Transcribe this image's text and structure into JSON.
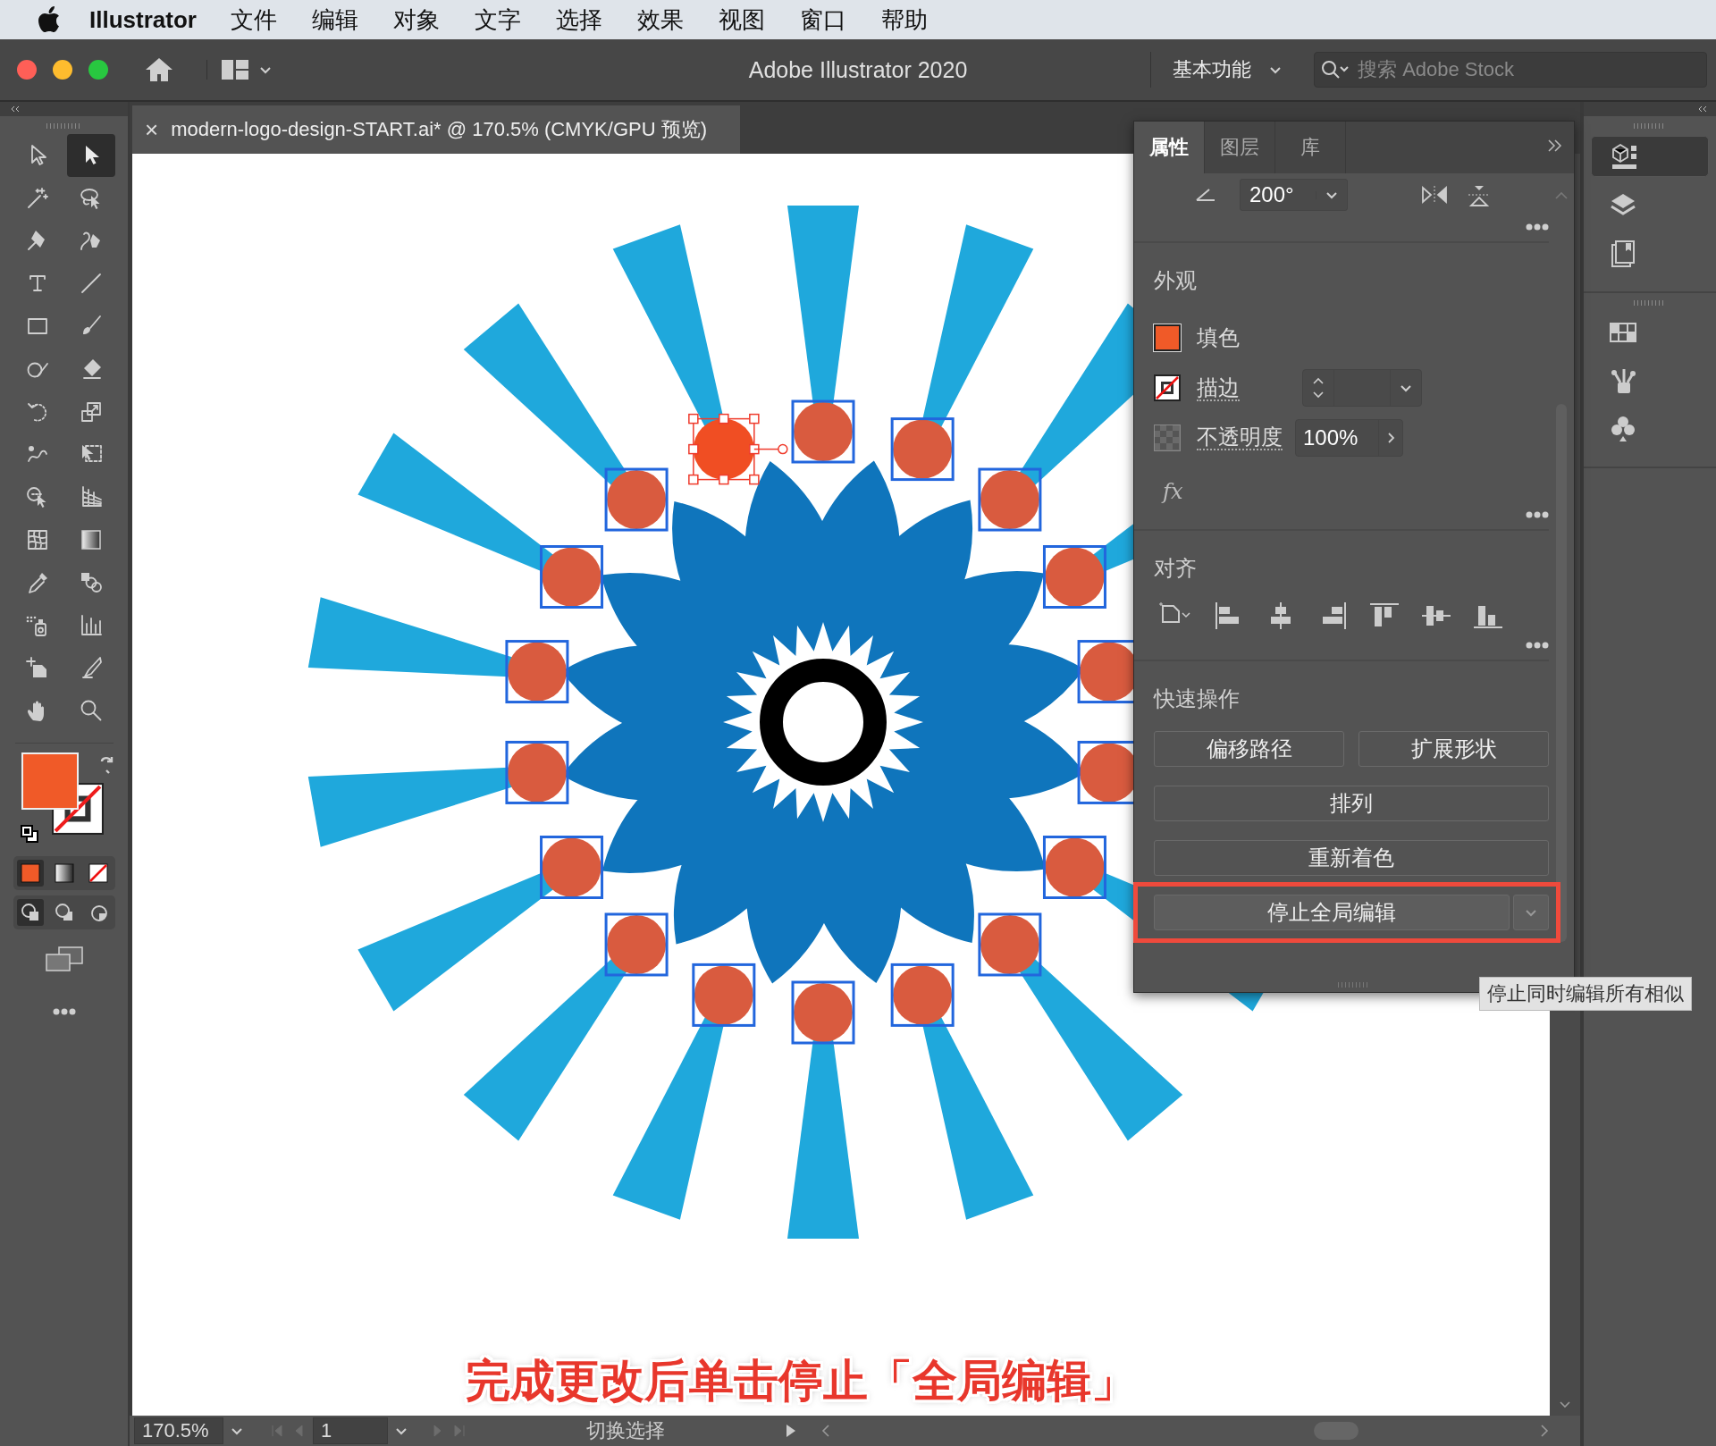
{
  "menu_bar": {
    "app_name": "Illustrator",
    "items": [
      "文件",
      "编辑",
      "对象",
      "文字",
      "选择",
      "效果",
      "视图",
      "窗口",
      "帮助"
    ]
  },
  "title_bar": {
    "title": "Adobe Illustrator 2020",
    "workspace": "基本功能",
    "search": {
      "placeholder": "搜索 Adobe Stock"
    }
  },
  "tools": [
    {
      "kind": "selection",
      "selected": false
    },
    {
      "kind": "direct-selection",
      "selected": true
    },
    {
      "kind": "magic-wand",
      "selected": false
    },
    {
      "kind": "lasso",
      "selected": false
    },
    {
      "kind": "pen",
      "selected": false
    },
    {
      "kind": "curvature",
      "selected": false
    },
    {
      "kind": "type",
      "selected": false
    },
    {
      "kind": "line",
      "selected": false
    },
    {
      "kind": "rectangle",
      "selected": false
    },
    {
      "kind": "paintbrush",
      "selected": false
    },
    {
      "kind": "shaper",
      "selected": false
    },
    {
      "kind": "eraser",
      "selected": false
    },
    {
      "kind": "rotate",
      "selected": false
    },
    {
      "kind": "scale",
      "selected": false
    },
    {
      "kind": "warp",
      "selected": false
    },
    {
      "kind": "free-transform",
      "selected": false
    },
    {
      "kind": "shape-builder",
      "selected": false
    },
    {
      "kind": "perspective-grid",
      "selected": false
    },
    {
      "kind": "mesh",
      "selected": false
    },
    {
      "kind": "gradient",
      "selected": false
    },
    {
      "kind": "eyedropper",
      "selected": false
    },
    {
      "kind": "blend",
      "selected": false
    },
    {
      "kind": "symbol-sprayer",
      "selected": false
    },
    {
      "kind": "column-graph",
      "selected": false
    },
    {
      "kind": "artboard",
      "selected": false
    },
    {
      "kind": "slice",
      "selected": false
    },
    {
      "kind": "hand",
      "selected": false
    },
    {
      "kind": "zoom",
      "selected": false
    }
  ],
  "fill_stroke": {
    "fill": {
      "color": "#f05a28"
    },
    "stroke": {
      "kind": "none"
    }
  },
  "color_modes": [
    {
      "kind": "color",
      "selected": true
    },
    {
      "kind": "gradient",
      "selected": false
    },
    {
      "kind": "none",
      "selected": false
    }
  ],
  "draw_modes": [
    {
      "kind": "normal",
      "selected": true
    },
    {
      "kind": "behind",
      "selected": false
    },
    {
      "kind": "inside",
      "selected": false
    }
  ],
  "document_tab": {
    "close": "×",
    "title": "modern-logo-design-START.ai* @ 170.5% (CMYK/GPU 预览)"
  },
  "artwork": {
    "circles": [
      {
        "selected": false
      },
      {
        "selected": false
      },
      {
        "selected": false
      },
      {
        "selected": false
      },
      {
        "selected": false
      },
      {
        "selected": false
      },
      {
        "selected": false
      },
      {
        "selected": false
      },
      {
        "selected": false
      },
      {
        "selected": false
      },
      {
        "selected": false
      },
      {
        "selected": false
      },
      {
        "selected": false
      },
      {
        "selected": false
      },
      {
        "selected": false
      },
      {
        "selected": false
      },
      {
        "selected": false
      },
      {
        "selected": true
      }
    ]
  },
  "caption": "完成更改后单击停止「全局编辑」",
  "properties_panel": {
    "tabs": [
      {
        "label": "属性",
        "selected": true
      },
      {
        "label": "图层",
        "selected": false
      },
      {
        "label": "库",
        "selected": false
      }
    ],
    "transform": {
      "angle": "200°"
    },
    "appearance": {
      "title": "外观",
      "fill": {
        "label": "填色",
        "color": "#f05a28"
      },
      "stroke": {
        "label": "描边",
        "kind": "none"
      },
      "opacity": {
        "label": "不透明度",
        "value": "100%"
      },
      "effects": "fx"
    },
    "align": {
      "title": "对齐"
    },
    "quick_actions": {
      "title": "快速操作",
      "buttons": [
        {
          "label": "偏移路径",
          "kind": "half",
          "highlighted": false
        },
        {
          "label": "扩展形状",
          "kind": "half",
          "highlighted": false
        },
        {
          "label": "排列",
          "kind": "full",
          "highlighted": false
        },
        {
          "label": "重新着色",
          "kind": "full",
          "highlighted": false
        },
        {
          "label": "停止全局编辑",
          "kind": "split",
          "highlighted": true
        }
      ]
    }
  },
  "tooltip": "停止同时编辑所有相似",
  "status_bar": {
    "zoom": "170.5%",
    "artboard": "1",
    "mode": "切换选择"
  },
  "dock": [
    {
      "kind": "properties",
      "selected": true
    },
    {
      "kind": "layers",
      "selected": false
    },
    {
      "kind": "libraries",
      "selected": false
    },
    {
      "kind": "swatches",
      "selected": false
    },
    {
      "kind": "brushes",
      "selected": false
    },
    {
      "kind": "symbols",
      "selected": false
    }
  ]
}
